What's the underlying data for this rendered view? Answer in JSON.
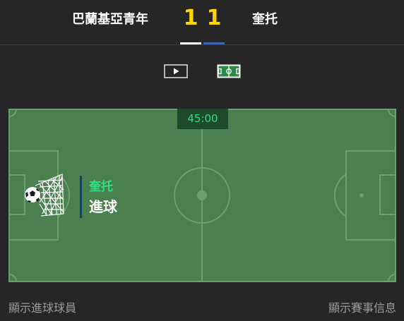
{
  "header": {
    "home_team": "巴蘭基亞青年",
    "away_team": "奎托",
    "home_score": "1",
    "away_score": "1"
  },
  "view_toggle": {
    "icons": [
      "video-play-icon",
      "pitch-view-icon"
    ]
  },
  "match": {
    "time": "45:00",
    "event_team": "奎托",
    "event_type": "進球"
  },
  "footer": {
    "show_scorers": "顯示進球球員",
    "show_match_info": "顯示賽事信息"
  },
  "colors": {
    "pitch": "#4a7f4f",
    "score": "#ffd400",
    "accent_green": "#2fe082",
    "away_bar": "#3d64b4"
  }
}
